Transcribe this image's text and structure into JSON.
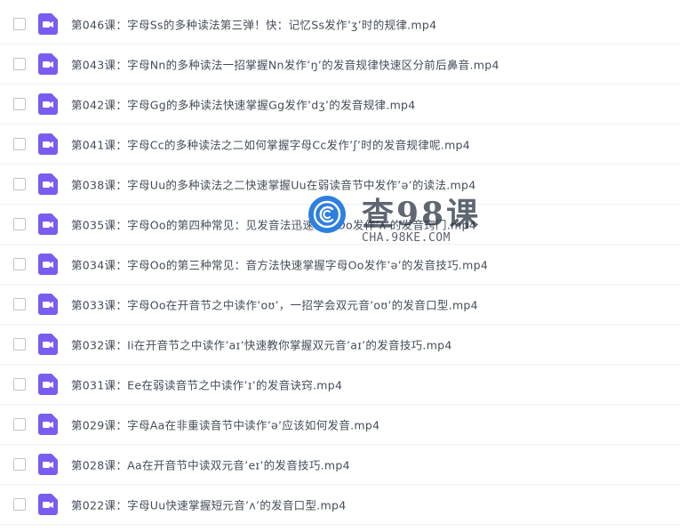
{
  "colors": {
    "icon_accent": "#7b5cf0",
    "text": "#454d5a",
    "watermark_blue": "#2d7fe0"
  },
  "file_icon": "video-file-icon",
  "files": [
    "第046课：字母Ss的多种读法第三弹！快：记忆Ss发作’ʒ’时的规律.mp4",
    "第043课：字母Nn的多种读法一招掌握Nn发作’ŋ’的发音规律快速区分前后鼻音.mp4",
    "第042课：字母Gg的多种读法快速掌握Gg发作’dʒ’的发音规律.mp4",
    "第041课：字母Cc的多种读法之二如何掌握字母Cc发作’ʃ’时的发音规律呢.mp4",
    "第038课：字母Uu的多种读法之二快速掌握Uu在弱读音节中发作’ə’的读法.mp4",
    "第035课：字母Oo的第四种常见：见发音法迅速掌握Oo发作’ʌ’的发音窍门.mp4",
    "第034课：字母Oo的第三种常见：音方法快速掌握字母Oo发作’ə’的发音技巧.mp4",
    "第033课：字母Oo在开音节之中读作’oʊ’，一招学会双元音’oʊ’的发音口型.mp4",
    "第032课：Ii在开音节之中读作’aɪ’快速教你掌握双元音’aɪ’的发音技巧.mp4",
    "第031课：Ee在弱读音节之中读作’ɪ’的发音诀窍.mp4",
    "第029课：字母Aa在非重读音节中读作’ə’应该如何发音.mp4",
    "第028课：Aa在开音节中读双元音’eɪ’的发音技巧.mp4",
    "第022课：字母Uu快速掌握短元音’ʌ’的发音口型.mp4"
  ],
  "watermark": {
    "title": "查98课",
    "url": "CHA.98KE.COM",
    "logo_icon": "c-logo-icon"
  }
}
